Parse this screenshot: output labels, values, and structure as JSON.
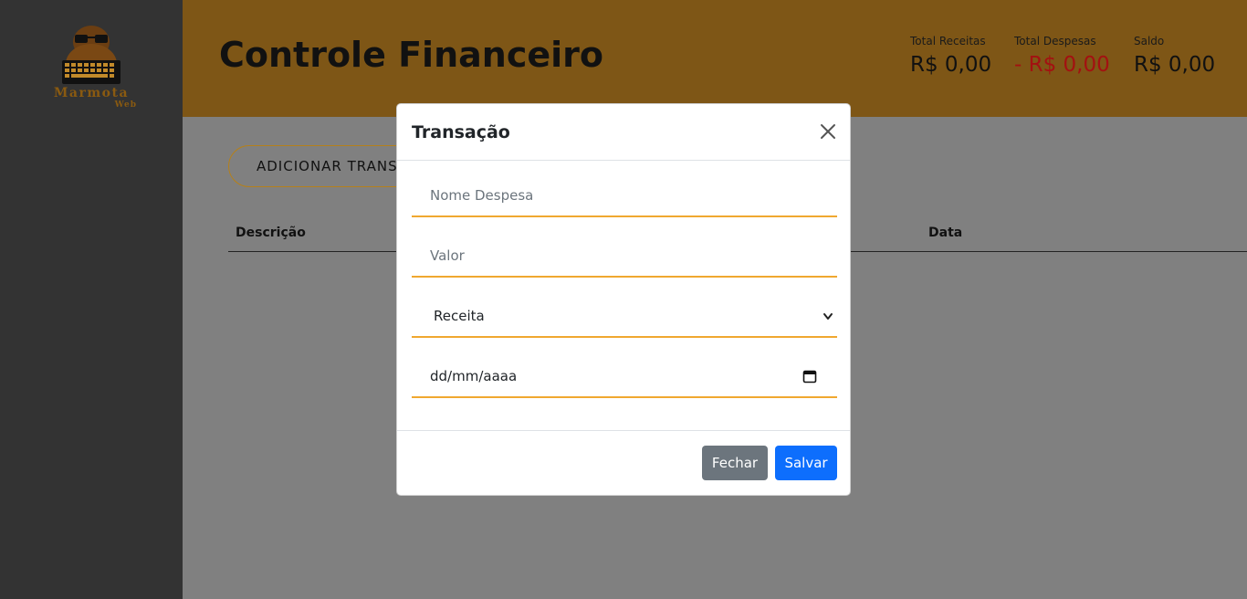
{
  "brand": {
    "name": "Marmota",
    "sub": "Web"
  },
  "header": {
    "title": "Controle Financeiro",
    "totals": [
      {
        "label": "Total Receitas",
        "value": "R$ 0,00"
      },
      {
        "label": "Total Despesas",
        "value": "- R$ 0,00"
      },
      {
        "label": "Saldo",
        "value": "R$ 0,00"
      }
    ]
  },
  "main": {
    "add_button": "ADICIONAR TRANSAÇÃO",
    "table": {
      "headers": [
        "Descrição",
        "Data"
      ]
    }
  },
  "modal": {
    "title": "Transação",
    "name_placeholder": "Nome Despesa",
    "value_placeholder": "Valor",
    "type_selected": "Receita",
    "date_placeholder": "dd/mm/aaaa",
    "close_label": "Fechar",
    "save_label": "Salvar"
  },
  "colors": {
    "sidebar": "#333333",
    "header": "#7e5616",
    "expense_red": "#a31111",
    "field_underline": "#f0a830",
    "save_button": "#0d6efd",
    "close_button": "#6c757d"
  }
}
